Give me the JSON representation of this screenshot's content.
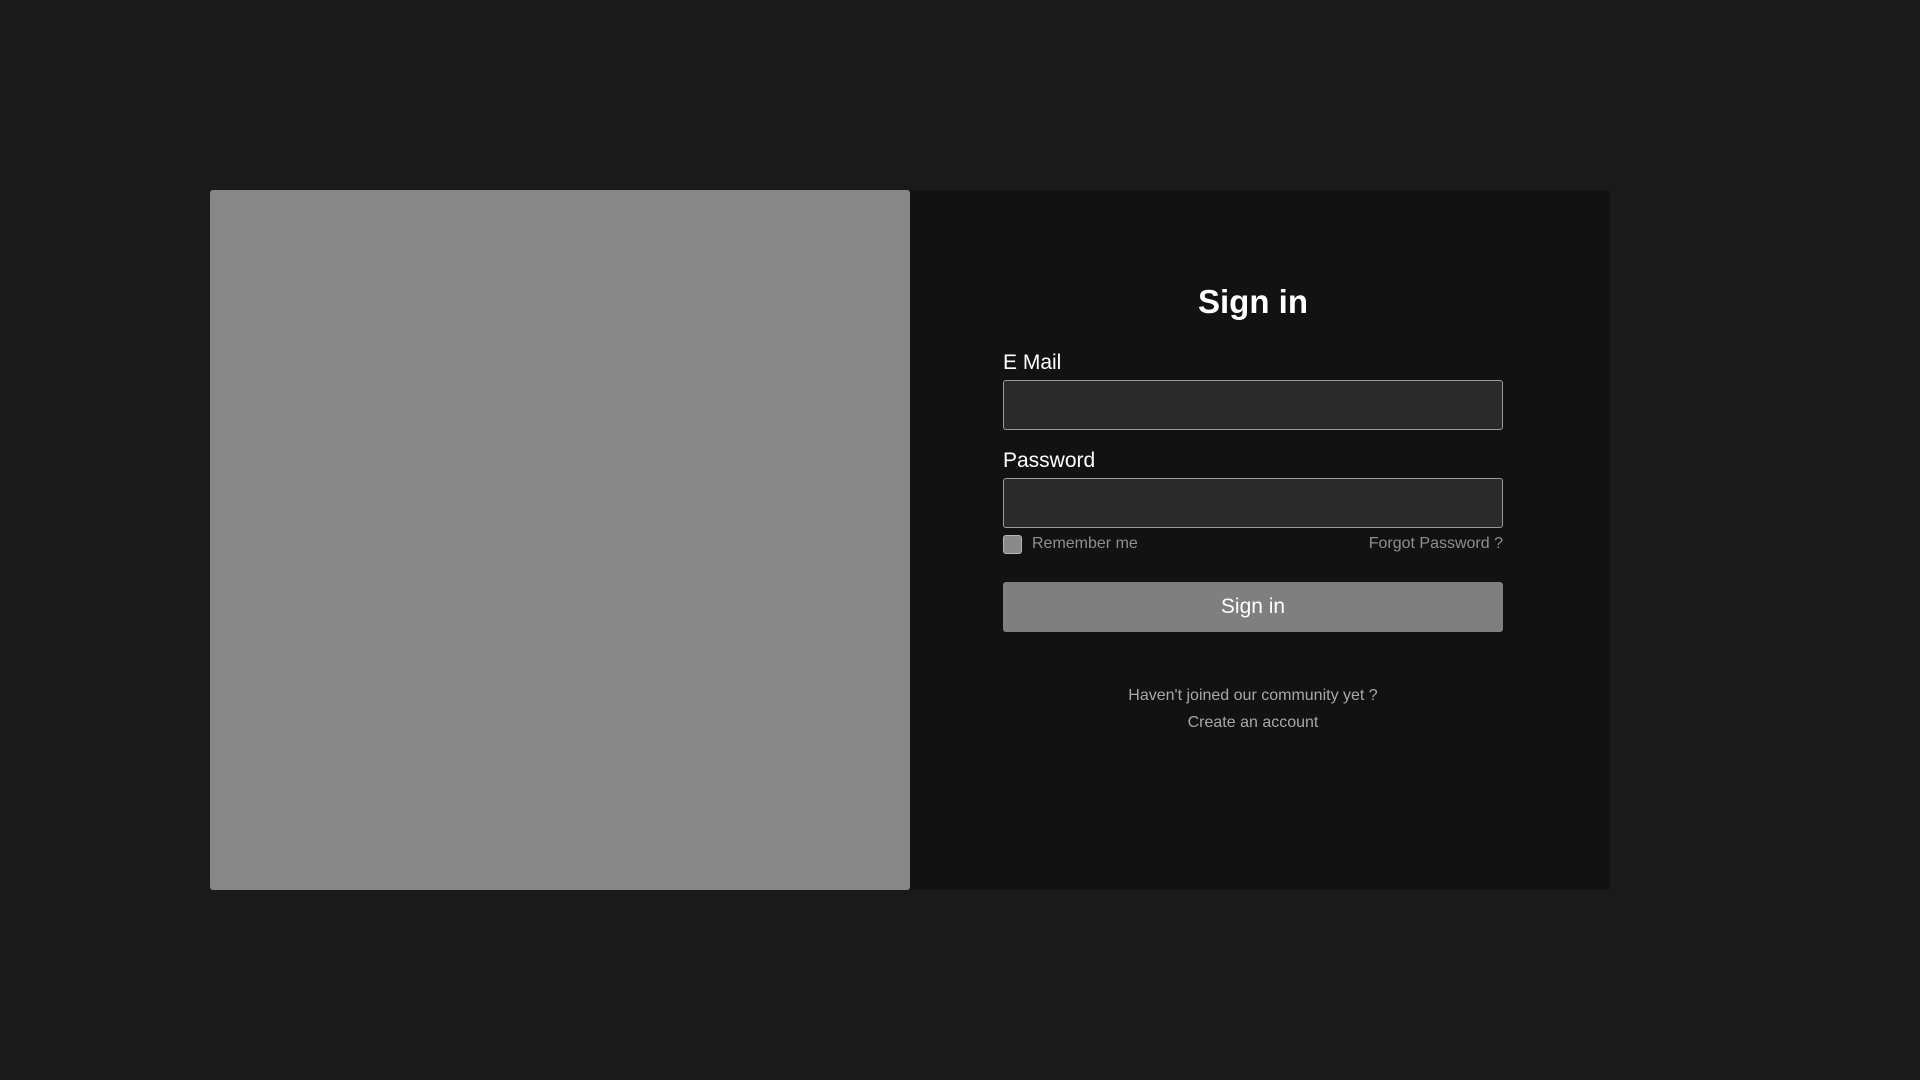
{
  "colors": {
    "page_background": "#1a1a1a",
    "image_panel": "#878787",
    "form_panel": "#121212",
    "input_background": "#2a2a2a",
    "button_background": "#7f7f7f"
  },
  "form": {
    "title": "Sign in",
    "email": {
      "label": "E Mail",
      "value": "",
      "placeholder": ""
    },
    "password": {
      "label": "Password",
      "value": "",
      "placeholder": ""
    },
    "remember_label": "Remember me",
    "remember_checked": false,
    "forgot_label": "Forgot Password ?",
    "submit_label": "Sign in"
  },
  "footer": {
    "prompt": "Haven't joined our community yet ?",
    "create_account_label": "Create an account"
  }
}
